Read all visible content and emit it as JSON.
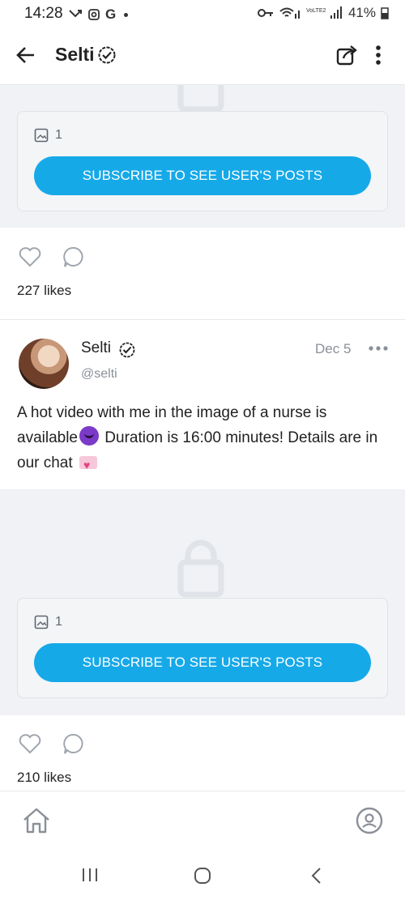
{
  "status_bar": {
    "time": "14:28",
    "battery": "41%"
  },
  "header": {
    "title": "Selti"
  },
  "locked_posts": [
    {
      "media_count": "1",
      "subscribe_label": "SUBSCRIBE TO SEE USER'S POSTS",
      "likes": "227 likes"
    },
    {
      "media_count": "1",
      "subscribe_label": "SUBSCRIBE TO SEE USER'S POSTS",
      "likes": "210 likes"
    }
  ],
  "post": {
    "author": "Selti",
    "handle": "@selti",
    "date": "Dec 5",
    "text_part1": "A hot video with me in the image of a nurse is available",
    "text_part2": " Duration is 16:00 minutes! Details are in our chat "
  },
  "colors": {
    "accent": "#16a9e8",
    "locked_bg": "#f0f2f5"
  }
}
